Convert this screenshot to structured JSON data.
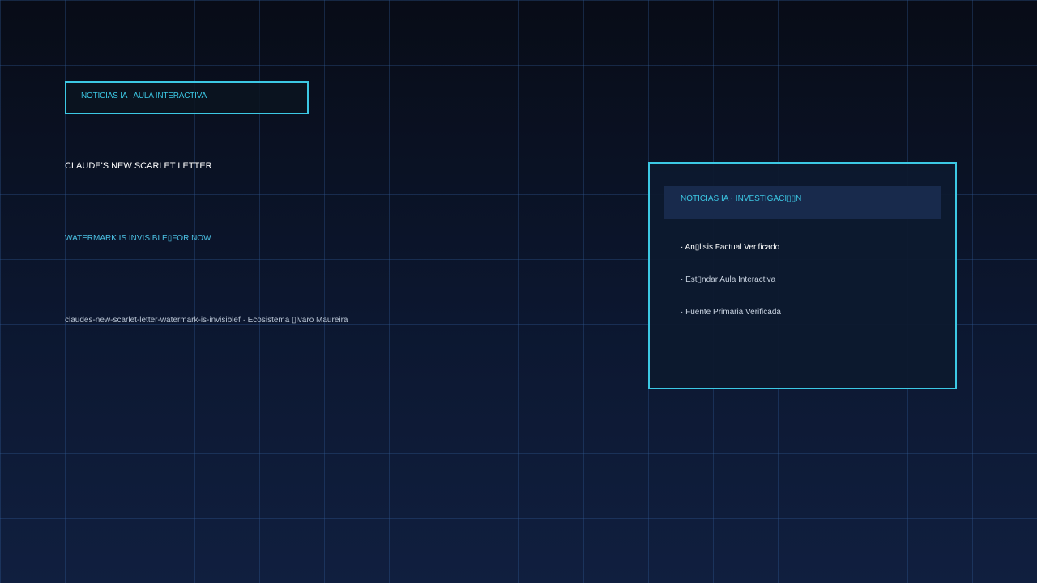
{
  "header": {
    "tag": "NOTICIAS IA · AULA INTERACTIVA"
  },
  "article": {
    "title": "CLAUDE'S NEW SCARLET LETTER",
    "subtitle": "WATERMARK IS INVISIBLE▯FOR NOW",
    "slug": "claudes-new-scarlet-letter-watermark-is-invisiblef · Ecosistema ▯lvaro Maureira"
  },
  "panel": {
    "header": "NOTICIAS IA · INVESTIGACI▯▯N",
    "items": [
      "· An▯lisis Factual Verificado",
      "· Est▯ndar Aula Interactiva",
      "· Fuente Primaria Verificada"
    ]
  },
  "colors": {
    "accent": "#3cc8e4",
    "background_top": "#080c17",
    "background_bottom": "#101f3f",
    "panel_header": "#182a4c",
    "grid_line": "#1e3a5f"
  }
}
